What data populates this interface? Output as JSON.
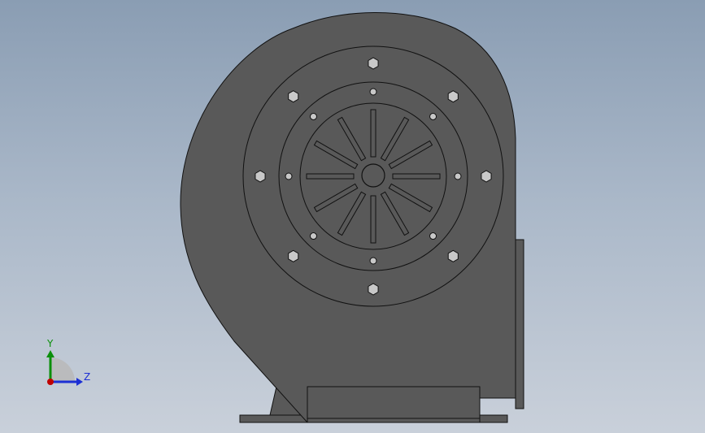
{
  "colors": {
    "background_top": "#8a9db3",
    "background_bottom": "#c9d0da",
    "body_fill": "#595959",
    "edge": "#111111",
    "bolt_fill": "#c8c8c8",
    "axis_y": "#0a8f0a",
    "axis_z": "#1c2fd4",
    "axis_x": "#c00000"
  },
  "triad": {
    "y_label": "Y",
    "z_label": "Z"
  }
}
